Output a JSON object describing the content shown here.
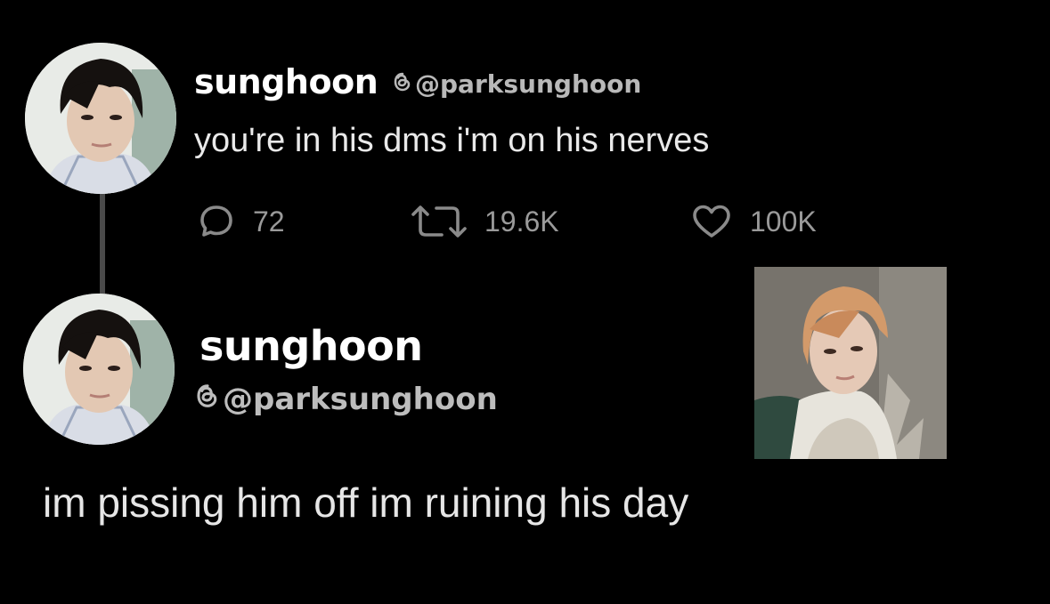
{
  "post1": {
    "display_name": "sunghoon",
    "handle": "@parksunghoon",
    "text": "you're in his dms i'm on his nerves",
    "stats": {
      "replies": "72",
      "reposts": "19.6K",
      "likes": "100K"
    }
  },
  "post2": {
    "display_name": "sunghoon",
    "handle": "@parksunghoon",
    "text": "im pissing him off im ruining his day"
  },
  "icons": {
    "reply": "reply-bubble-icon",
    "repost": "repost-arrows-icon",
    "like": "heart-icon",
    "handle_badge": "threads-icon"
  },
  "colors": {
    "background": "#000000",
    "text_primary": "#ffffff",
    "text_secondary": "#b9b9b9",
    "icon_gray": "#8a8a8a",
    "thread_line": "#4a4a4a"
  }
}
